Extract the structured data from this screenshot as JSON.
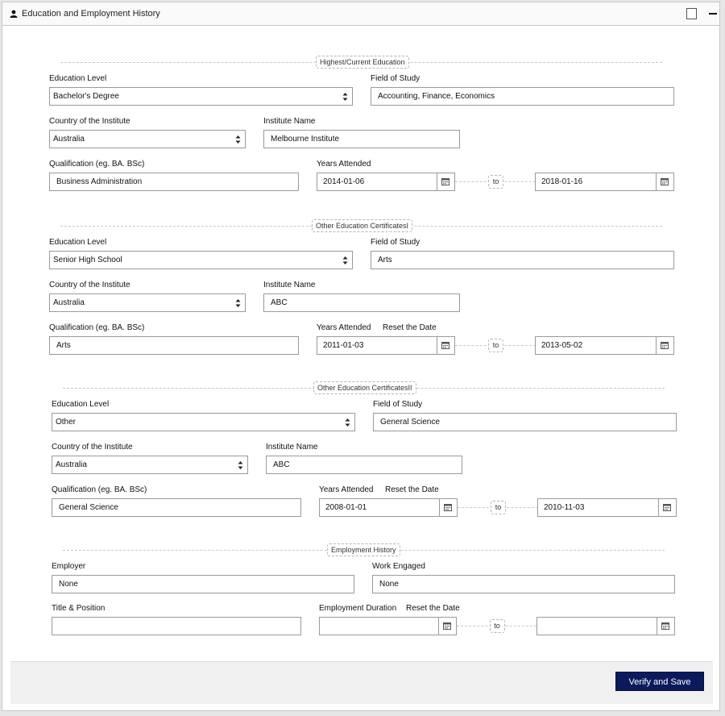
{
  "window": {
    "title": "Education and Employment History",
    "maximize_icon": "square-icon",
    "minimize_icon": "minus-icon",
    "title_icon": "user-icon"
  },
  "sections": [
    {
      "legend": "Highest/Current Education",
      "education_level_label": "Education Level",
      "education_level_value": "Bachelor's Degree",
      "field_of_study_label": "Field of Study",
      "field_of_study_value": "Accounting, Finance, Economics",
      "country_label": "Country of the Institute",
      "country_value": "Australia",
      "institute_label": "Institute Name",
      "institute_value": "Melbourne Institute",
      "qualification_label": "Qualification (eg. BA. BSc)",
      "qualification_value": "Business Administration",
      "years_label": "Years Attended",
      "reset_label": "",
      "date_from": "2014-01-06",
      "to_label": "to",
      "date_to": "2018-01-16"
    },
    {
      "legend": "Other Education CertificatesI",
      "education_level_label": "Education Level",
      "education_level_value": "Senior High School",
      "field_of_study_label": "Field of Study",
      "field_of_study_value": "Arts",
      "country_label": "Country of the Institute",
      "country_value": "Australia",
      "institute_label": "Institute Name",
      "institute_value": "ABC",
      "qualification_label": "Qualification (eg. BA. BSc)",
      "qualification_value": "Arts",
      "years_label": "Years Attended",
      "reset_label": "Reset the Date",
      "date_from": "2011-01-03",
      "to_label": "to",
      "date_to": "2013-05-02"
    },
    {
      "legend": "Other Education CertificatesII",
      "education_level_label": "Education Level",
      "education_level_value": "Other",
      "field_of_study_label": "Field of Study",
      "field_of_study_value": "General Science",
      "country_label": "Country of the Institute",
      "country_value": "Australia",
      "institute_label": "Institute Name",
      "institute_value": "ABC",
      "qualification_label": "Qualification (eg. BA. BSc)",
      "qualification_value": "General Science",
      "years_label": "Years Attended",
      "reset_label": "Reset the Date",
      "date_from": "2008-01-01",
      "to_label": "to",
      "date_to": "2010-11-03"
    }
  ],
  "employment": {
    "legend": "Employment History",
    "employer_label": "Employer",
    "employer_value": "None",
    "work_label": "Work Engaged",
    "work_value": "None",
    "title_label": "Title & Position",
    "title_value": "",
    "duration_label": "Employment Duration",
    "reset_label": "Reset the Date",
    "date_from": "",
    "to_label": "to",
    "date_to": ""
  },
  "footer": {
    "verify_label": "Verify and Save"
  },
  "colors": {
    "primary_button": "#0a1a5c",
    "border": "#9a9a9a"
  }
}
